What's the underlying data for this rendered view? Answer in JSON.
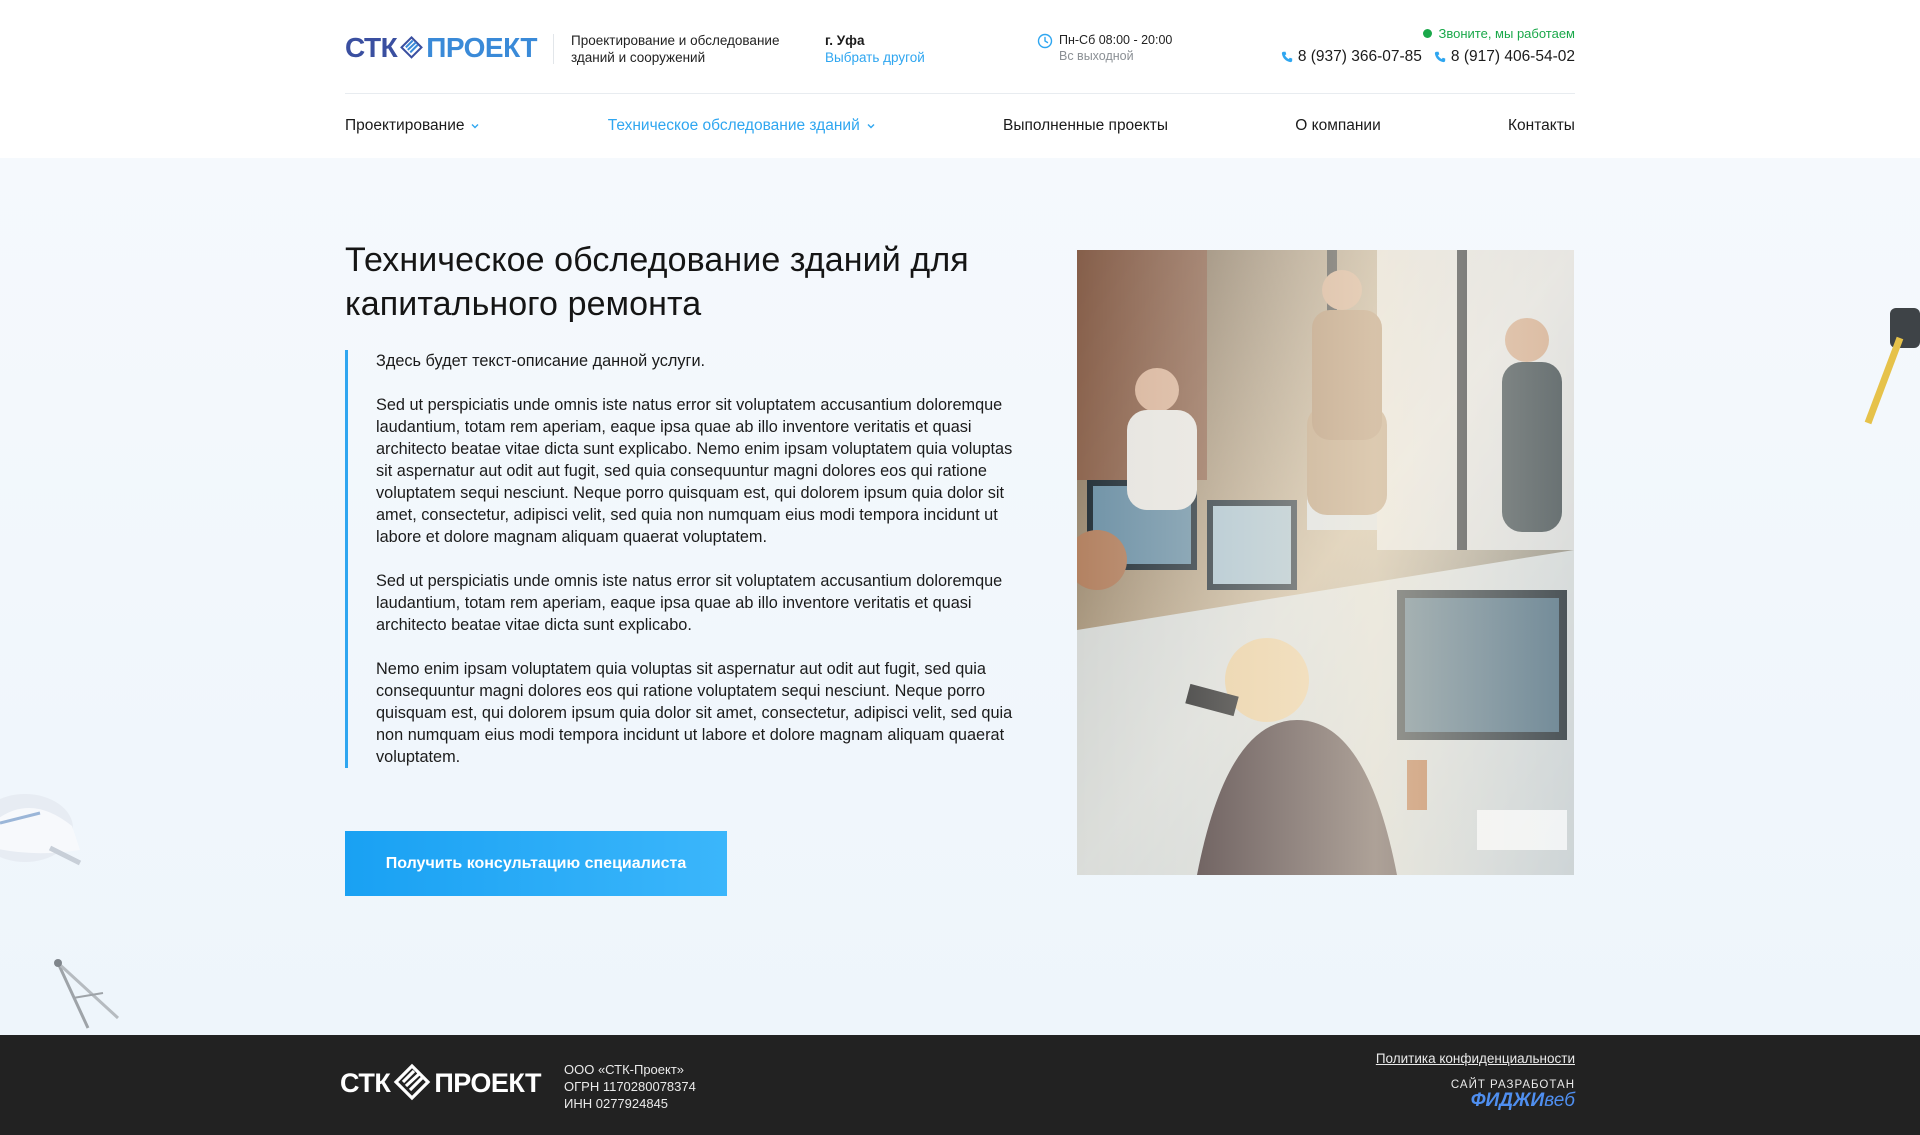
{
  "header": {
    "logo_left": "СТК",
    "logo_right": "ПРОЕКТ",
    "tagline": "Проектирование и обследование зданий и сооружений",
    "city": "г. Уфа",
    "city_change": "Выбрать другой",
    "hours": "Пн-Сб 08:00 - 20:00",
    "hours_note": "Вс выходной",
    "call_status": "Звоните, мы работаем",
    "phones": [
      "8 (937) 366-07-85",
      "8 (917) 406-54-02"
    ]
  },
  "nav": [
    {
      "label": "Проектирование",
      "dropdown": true
    },
    {
      "label": "Техническое обследование зданий",
      "dropdown": true,
      "active": true
    },
    {
      "label": "Выполненные проекты"
    },
    {
      "label": "О компании"
    },
    {
      "label": "Контакты"
    }
  ],
  "main": {
    "title": "Техническое обследование зданий для капитального ремонта",
    "paragraphs": [
      "Здесь будет текст-описание данной услуги.",
      "Sed ut perspiciatis unde omnis iste natus error sit voluptatem accusantium doloremque laudantium, totam rem aperiam, eaque ipsa quae ab illo inventore veritatis et quasi architecto beatae vitae dicta sunt explicabo. Nemo enim ipsam voluptatem quia voluptas sit aspernatur aut odit aut fugit, sed quia consequuntur magni dolores eos qui ratione voluptatem sequi nesciunt. Neque porro quisquam est, qui dolorem ipsum quia dolor sit amet, consectetur, adipisci velit, sed quia non numquam eius modi tempora incidunt ut labore et dolore magnam aliquam quaerat voluptatem.",
      "Sed ut perspiciatis unde omnis iste natus error sit voluptatem accusantium doloremque laudantium, totam rem aperiam, eaque ipsa quae ab illo inventore veritatis et quasi architecto beatae vitae dicta sunt explicabo.",
      "Nemo enim ipsam voluptatem quia voluptas sit aspernatur aut odit aut fugit, sed quia consequuntur magni dolores eos qui ratione voluptatem sequi nesciunt. Neque porro quisquam est, qui dolorem ipsum quia dolor sit amet, consectetur, adipisci velit, sed quia non numquam eius modi tempora incidunt ut labore et dolore magnam aliquam quaerat voluptatem."
    ],
    "cta_label": "Получить консультацию специалиста"
  },
  "footer": {
    "logo_left": "СТК",
    "logo_right": "ПРОЕКТ",
    "company_name": "ООО «СТК-Проект»",
    "ogrn": "ОГРН 1170280078374",
    "inn": "ИНН 0277924845",
    "policy": "Политика конфиденциальности",
    "dev_label": "САЙТ РАЗРАБОТАН",
    "dev_brand_bold": "ФИДЖИ",
    "dev_brand_light": "веб"
  },
  "colors": {
    "accent": "#2fa6f0",
    "logo_dark": "#3a4fa0",
    "logo_light": "#3a8ad8",
    "status_green": "#1aa84a",
    "footer_bg": "#222222"
  },
  "icons": [
    "logo-mark-icon",
    "clock-icon",
    "phone-icon",
    "chevron-down-icon",
    "helmet-decoration-icon",
    "compass-decoration-icon",
    "tape-measure-decoration-icon"
  ]
}
